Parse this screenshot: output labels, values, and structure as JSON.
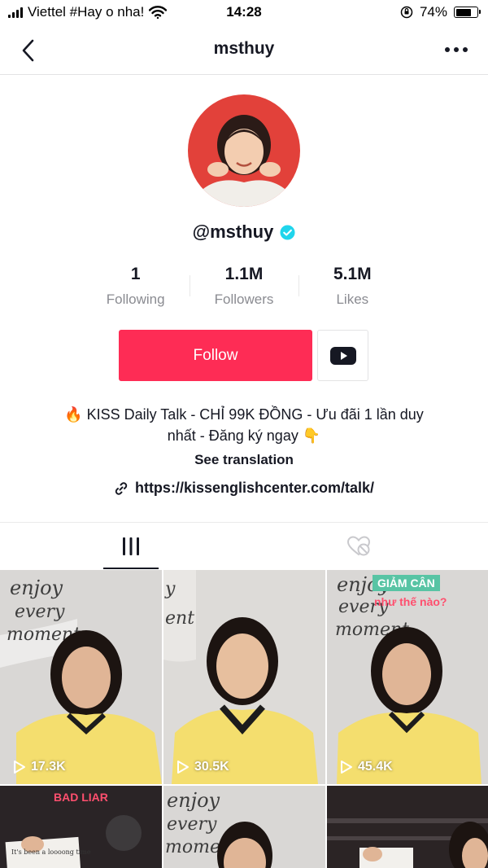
{
  "status_bar": {
    "carrier": "Viettel #Hay o nha!",
    "time": "14:28",
    "battery": "74%",
    "battery_level": 0.74
  },
  "nav": {
    "title": "msthuy",
    "back_icon": "chevron-left-icon",
    "more_icon": "ellipsis-icon"
  },
  "profile": {
    "handle": "@msthuy",
    "verified_icon": "verified-badge-icon",
    "stats": [
      {
        "value": "1",
        "label": "Following"
      },
      {
        "value": "1.1M",
        "label": "Followers"
      },
      {
        "value": "5.1M",
        "label": "Likes"
      }
    ],
    "follow_label": "Follow",
    "youtube_icon": "youtube-icon",
    "bio_line1": "🔥 KISS Daily Talk - CHỈ 99K ĐỒNG - Ưu đãi 1 lần duy",
    "bio_line2": "nhất - Đăng ký ngay 👇",
    "see_translation": "See translation",
    "link": "https://kissenglishcenter.com/talk/"
  },
  "tabs": {
    "videos_icon": "grid-bars-icon",
    "liked_icon": "hidden-heart-icon"
  },
  "videos": [
    {
      "views": "17.3K",
      "overlay": ""
    },
    {
      "views": "30.5K",
      "overlay": ""
    },
    {
      "views": "45.4K",
      "overlay_top": "GIẢM CÂN",
      "overlay_bottom": "như thế nào?"
    },
    {
      "views": "",
      "overlay": "BAD LIAR"
    },
    {
      "views": "",
      "overlay": ""
    },
    {
      "views": "",
      "overlay": ""
    }
  ],
  "colors": {
    "accent": "#fe2c55",
    "verified": "#20d5ec",
    "shirt": "#f4de6e"
  }
}
